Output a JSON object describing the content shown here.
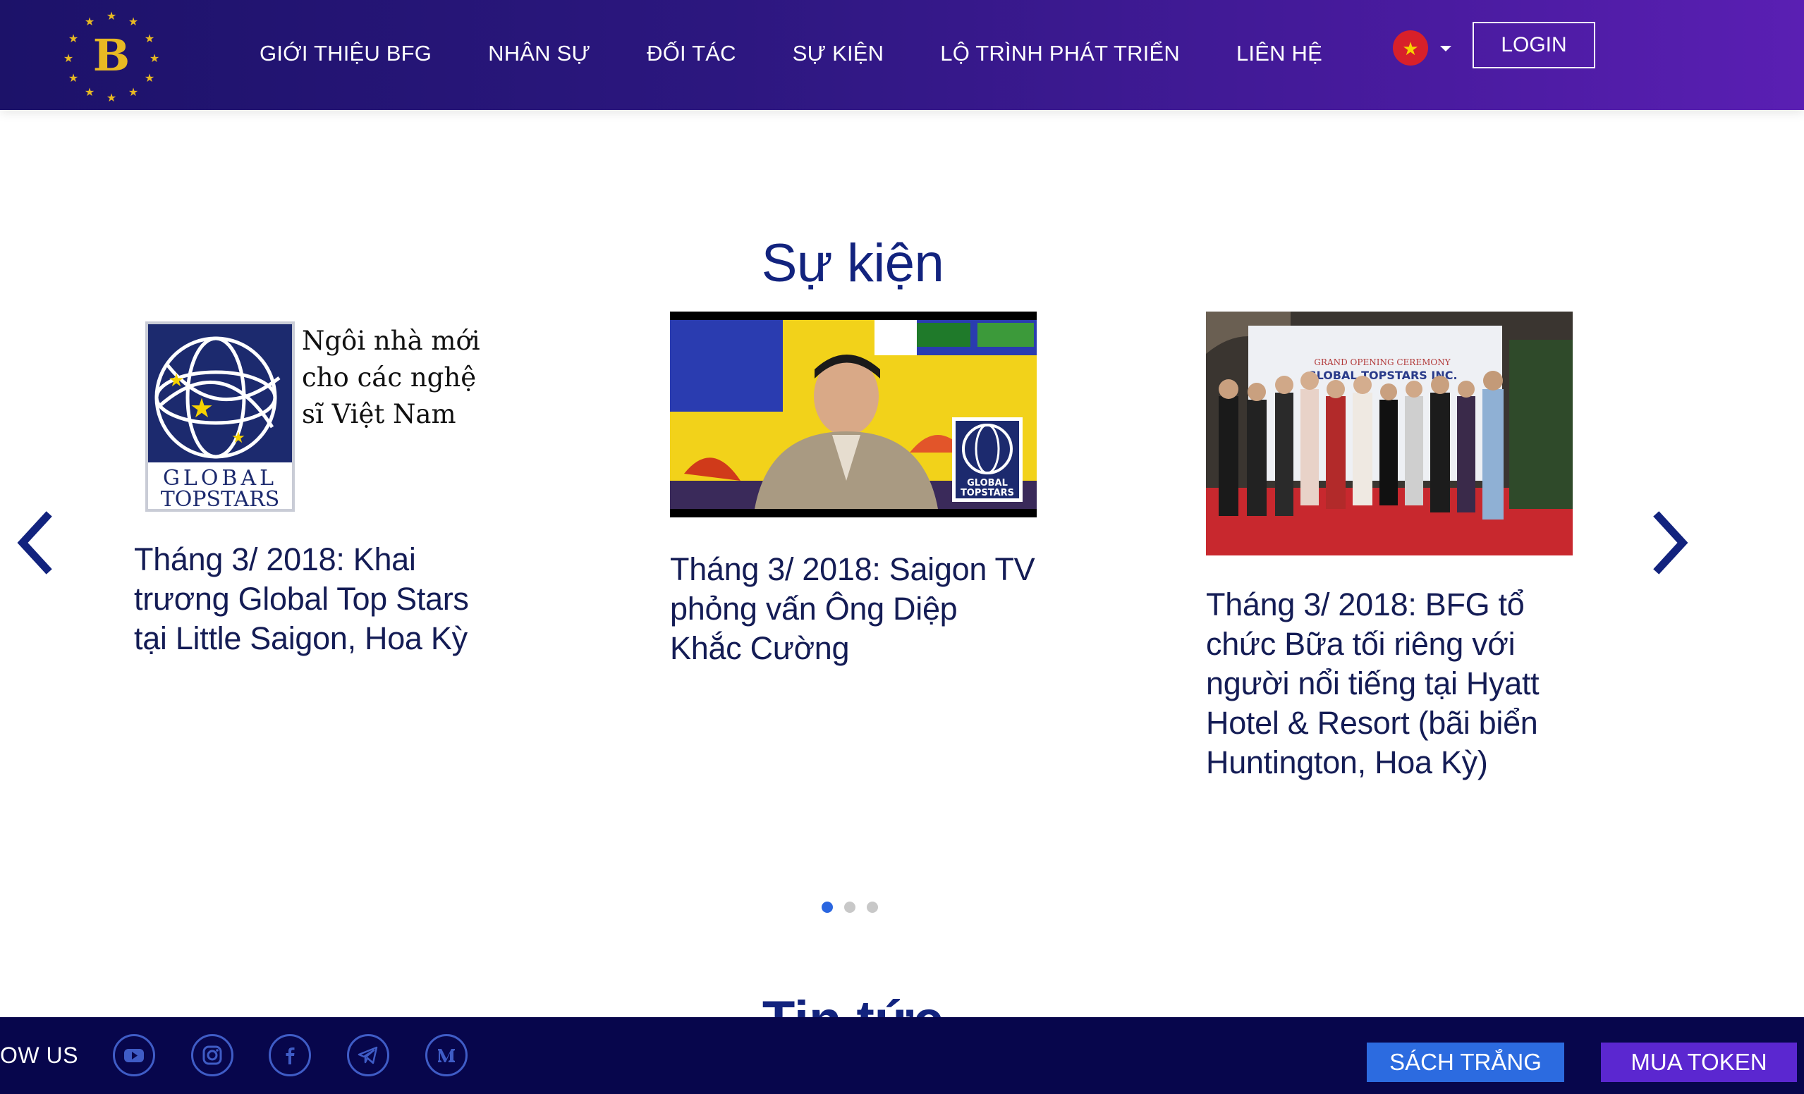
{
  "header": {
    "logo_letter": "B",
    "nav": [
      {
        "label": "GIỚI THIỆU BFG"
      },
      {
        "label": "NHÂN SỰ"
      },
      {
        "label": "ĐỐI TÁC"
      },
      {
        "label": "SỰ KIỆN"
      },
      {
        "label": "LỘ TRÌNH PHÁT TRIỂN"
      },
      {
        "label": "LIÊN HỆ"
      }
    ],
    "language_icon": "vietnam-flag-icon",
    "login_label": "LOGIN"
  },
  "events": {
    "title": "Sự kiện",
    "cards": [
      {
        "title": "Tháng 3/ 2018: Khai trương Global Top Stars tại Little Saigon, Hoa Kỳ",
        "image_text": {
          "slogan": "Ngôi nhà mới cho các nghệ sĩ Việt Nam",
          "brand_line1": "GLOBAL",
          "brand_line2": "TOPSTARS"
        }
      },
      {
        "title": "Tháng 3/ 2018: Saigon TV phỏng vấn Ông Diệp Khắc Cường",
        "image_text": {
          "brand_line1": "GLOBAL",
          "brand_line2": "TOPSTARS"
        }
      },
      {
        "title": "Tháng 3/ 2018: BFG tổ chức Bữa tối riêng với người nổi tiếng tại Hyatt Hotel & Resort (bãi biển Huntington, Hoa Kỳ)",
        "image_text": {
          "banner_top": "GRAND OPENING CEREMONY",
          "banner_main": "GLOBAL TOPSTARS INC."
        }
      }
    ],
    "pagination": {
      "active": 1,
      "total": 3
    }
  },
  "next_section_title": "Tin tức",
  "footer": {
    "follow_label": "OW US",
    "social": [
      "youtube-icon",
      "instagram-icon",
      "facebook-icon",
      "telegram-icon",
      "medium-icon"
    ],
    "whitepaper_label": "SÁCH TRẮNG",
    "buy_token_label": "MUA TOKEN"
  },
  "colors": {
    "header_gradient_start": "#1c1269",
    "header_gradient_end": "#5a1fb3",
    "title_blue": "#12237e",
    "card_text": "#141c55",
    "footer_bg": "#07064c",
    "whitepaper_btn": "#2c6be0",
    "token_btn": "#5b27d0",
    "dot_active": "#2a66e0"
  }
}
